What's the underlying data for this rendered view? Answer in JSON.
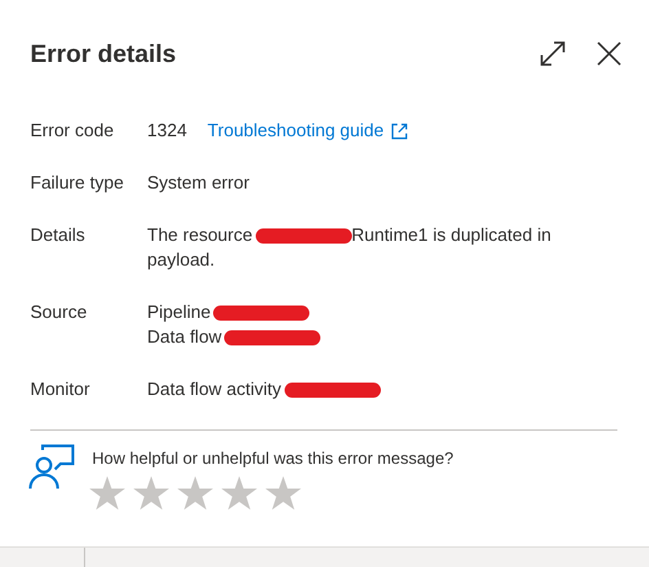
{
  "panel": {
    "title": "Error details"
  },
  "fields": [
    {
      "label": "Error code",
      "lines": [
        [
          {
            "kind": "text",
            "text": "1324"
          },
          {
            "kind": "link",
            "text": "Troubleshooting guide"
          }
        ]
      ]
    },
    {
      "label": "Failure type",
      "lines": [
        [
          {
            "kind": "text",
            "text": "System error"
          }
        ]
      ]
    },
    {
      "label": "Details",
      "lines": [
        [
          {
            "kind": "text",
            "text": "The resource"
          },
          {
            "kind": "redaction"
          },
          {
            "kind": "text",
            "text": "Runtime1 is duplicated in"
          }
        ],
        [
          {
            "kind": "text",
            "text": "payload."
          }
        ]
      ]
    },
    {
      "label": "Source",
      "lines": [
        [
          {
            "kind": "text",
            "text": "Pipeline"
          },
          {
            "kind": "redaction"
          }
        ],
        [
          {
            "kind": "text",
            "text": "Data flow"
          },
          {
            "kind": "redaction"
          }
        ]
      ]
    },
    {
      "label": "Monitor",
      "lines": [
        [
          {
            "kind": "text",
            "text": "Data flow activity"
          },
          {
            "kind": "redaction"
          }
        ]
      ]
    }
  ],
  "feedback": {
    "question": "How helpful or unhelpful was this error message?",
    "stars": 0
  }
}
